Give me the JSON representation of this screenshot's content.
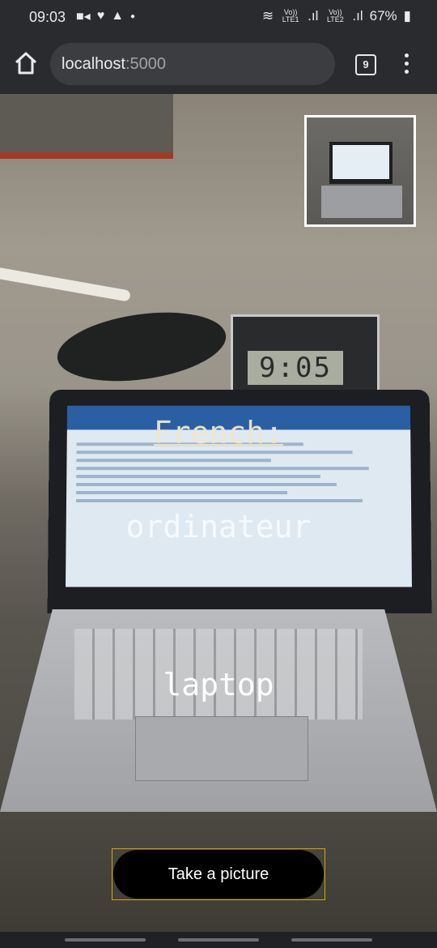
{
  "status_bar": {
    "time": "09:03",
    "lte1": "Vo)) LTE1",
    "lte2": "Vo)) LTE2",
    "battery": "67%"
  },
  "browser": {
    "url_host": "localhost",
    "url_port": ":5000",
    "tab_count": "9"
  },
  "camera": {
    "clock_display": "9:05",
    "overlay": {
      "language_label": "French:",
      "translation": "ordinateur",
      "english_word": "laptop"
    }
  },
  "capture_button": {
    "label": "Take a picture"
  }
}
